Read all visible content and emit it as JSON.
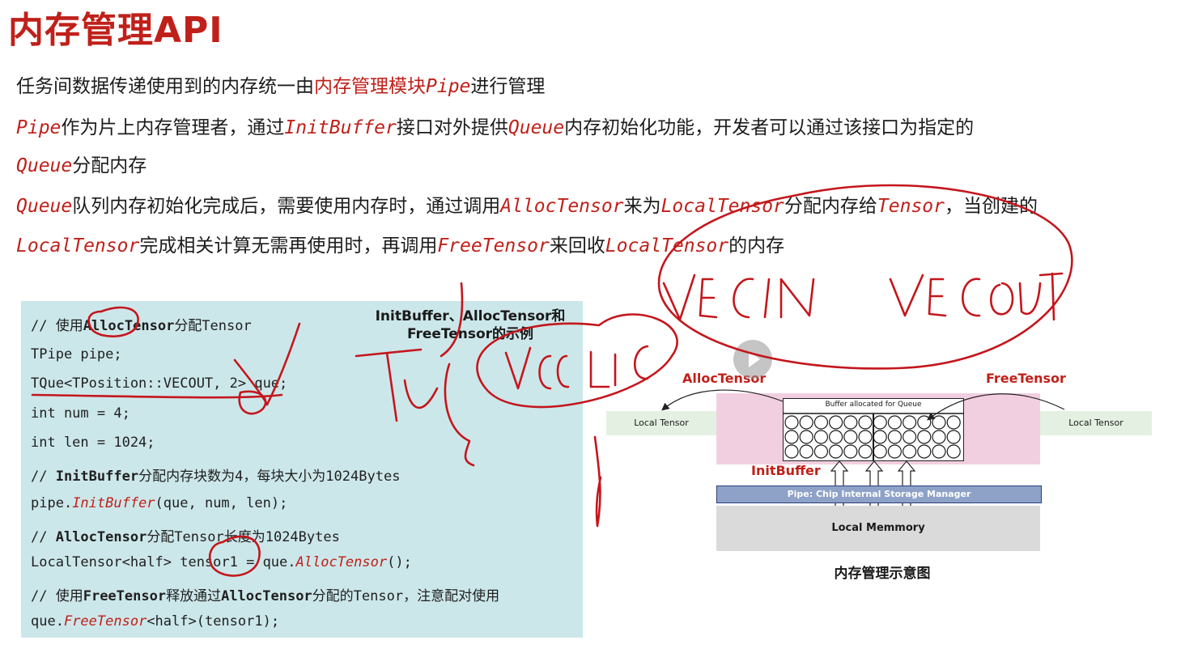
{
  "title": "内存管理API",
  "paragraphs": {
    "p1_a": "任务间数据传递使用到的内存统一由",
    "p1_kw": "内存管理模块",
    "p1_kw2": "Pipe",
    "p1_b": "进行管理",
    "p2_kw1": "Pipe",
    "p2_a": "作为片上内存管理者，通过",
    "p2_kw2": "InitBuffer",
    "p2_b": "接口对外提供",
    "p2_kw3": "Queue",
    "p2_c": "内存初始化功能，开发者可以通过该接口为指定的",
    "p3_kw": "Queue",
    "p3_a": "分配内存",
    "p4_kw1": "Queue",
    "p4_a": "队列内存初始化完成后，需要使用内存时，通过调用",
    "p4_kw2": "AllocTensor",
    "p4_b": "来为",
    "p4_kw3": "LocalTensor",
    "p4_c": "分配内存给",
    "p4_kw4": "Tensor",
    "p4_d": "，当创建的",
    "p5_kw1": "LocalTensor",
    "p5_a": "完成相关计算无需再使用时，再调用",
    "p5_kw2": "FreeTensor",
    "p5_b": "来回收",
    "p5_kw3": "LocalTensor",
    "p5_c": "的内存"
  },
  "code": {
    "caption_line1": "InitBuffer、AllocTensor和",
    "caption_line2": "FreeTensor的示例",
    "l1_a": "// 使用",
    "l1_b": "AllocTensor",
    "l1_c": "分配Tensor",
    "l2": "TPipe pipe;",
    "l3": "TQue<TPosition::VECOUT, 2> que;",
    "l4": "int num = 4;",
    "l5": "int len = 1024;",
    "l6_a": "// ",
    "l6_b": "InitBuffer",
    "l6_c": "分配内存块数为4，每块大小为1024Bytes",
    "l7_a": "pipe.",
    "l7_fn": "InitBuffer",
    "l7_b": "(que, num, len);",
    "l8_a": "// ",
    "l8_b": "AllocTensor",
    "l8_c": "分配Tensor长度为1024Bytes",
    "l9_a": "LocalTensor<half> tensor1 = que.",
    "l9_fn": "AllocTensor",
    "l9_b": "();",
    "l10_a": "// 使用",
    "l10_b": "FreeTensor",
    "l10_c": "释放通过",
    "l10_d": "AllocTensor",
    "l10_e": "分配的Tensor，注意配对使用",
    "l11_a": "que.",
    "l11_fn": "FreeTensor",
    "l11_b": "<half>(tensor1);"
  },
  "diagram": {
    "alloc_label": "AllocTensor",
    "free_label": "FreeTensor",
    "initbuffer_label": "InitBuffer",
    "buffer_label": "Buffer allocated for Queue",
    "local_tensor_left": "Local Tensor",
    "local_tensor_right": "Local Tensor",
    "pipe_label": "Pipe: Chip Internal Storage Manager",
    "local_memory": "Local Memmory",
    "caption": "内存管理示意图"
  },
  "colors": {
    "accent_red": "#c0201a",
    "code_bg": "#cce7ea",
    "pink": "#f2cfe0",
    "pipe_blue": "#8ea2c8"
  }
}
